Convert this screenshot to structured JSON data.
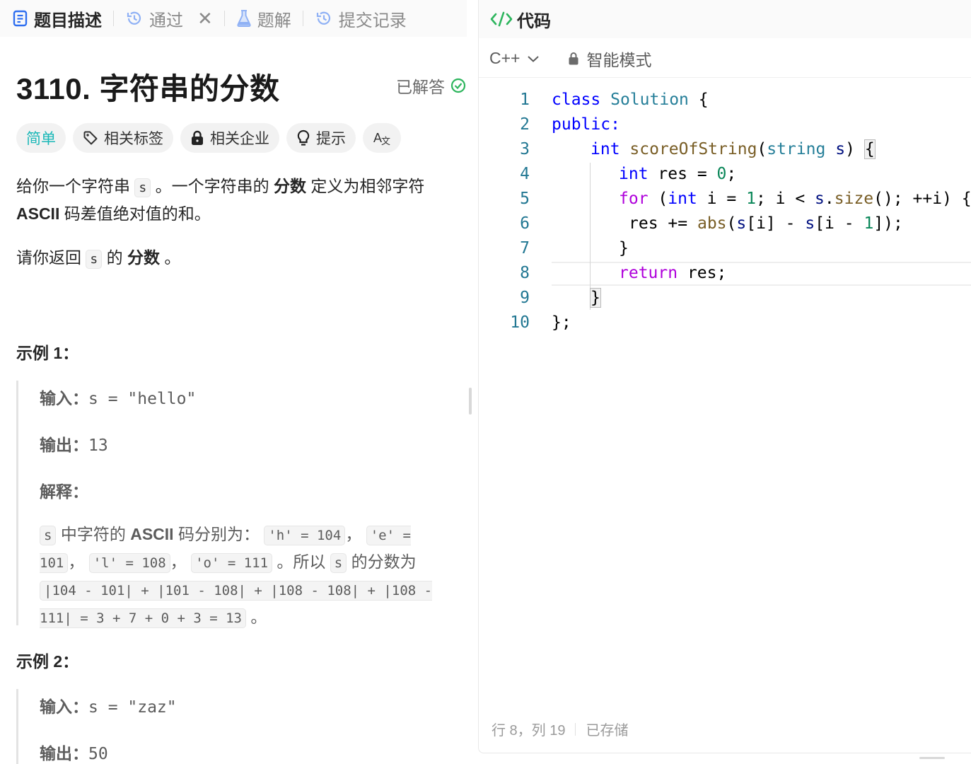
{
  "left_tabs": [
    {
      "label": "题目描述",
      "icon": "description-icon"
    },
    {
      "label": "通过",
      "icon": "history-icon"
    },
    {
      "label": "题解",
      "icon": "flask-icon"
    },
    {
      "label": "提交记录",
      "icon": "history-icon"
    }
  ],
  "problem": {
    "title": "3110. 字符串的分数",
    "status": "已解答",
    "tags": {
      "difficulty": "简单",
      "related_tags": "相关标签",
      "related_companies": "相关企业",
      "hint": "提示",
      "translate_icon": "translate-icon"
    },
    "desc1": {
      "a": "给你一个字符串",
      "code_s": "s",
      "b": "。一个字符串的",
      "bold": "分数",
      "c": "定义为相邻字符",
      "line2_bold": "ASCII",
      "line2_rest": "码差值绝对值的和。"
    },
    "desc2": {
      "a": "请你返回",
      "code_s": "s",
      "b": "的",
      "bold": "分数",
      "c": "。"
    },
    "example1": {
      "title": "示例 1：",
      "input_label": "输入：",
      "input_value": "s = \"hello\"",
      "output_label": "输出：",
      "output_value": "13",
      "explain_label": "解释：",
      "explain": {
        "code_s": "s",
        "t1": "中字符的",
        "ascii": "ASCII",
        "t2": "码分别为：",
        "h": "'h' = 104",
        "comma1": "，",
        "e": "'e' = 101",
        "comma2": "，",
        "l": "'l' = 108",
        "comma3": "，",
        "o": "'o' = 111",
        "t3": "。所以",
        "code_s2": "s",
        "t4": "的分数为",
        "expr": "|104 - 101| + |101 - 108| + |108 - 108| + |108 - 111| = 3 + 7 + 0 + 3 = 13",
        "end": "。"
      }
    },
    "example2": {
      "title": "示例 2：",
      "input_label": "输入：",
      "input_value": "s = \"zaz\"",
      "output_label": "输出：",
      "output_value": "50"
    }
  },
  "code_panel": {
    "title": "代码",
    "language": "C++",
    "mode": "智能模式",
    "line_numbers": [
      "1",
      "2",
      "3",
      "4",
      "5",
      "6",
      "7",
      "8",
      "9",
      "10"
    ],
    "lines": {
      "l1_kw": "class",
      "l1_name": "Solution",
      "l1_brace": "{",
      "l2": "public:",
      "l3_type": "int",
      "l3_fn": "scoreOfString",
      "l3_paren": "(",
      "l3_ptype": "string",
      "l3_param": "s",
      "l3_close": ")",
      "l3_brace": "{",
      "l4_type": "int",
      "l4_var": "res",
      "l4_eq": "=",
      "l4_num": "0",
      "l4_semi": ";",
      "l5_for": "for",
      "l5_open": "(",
      "l5_type": "int",
      "l5_rest1": "i =",
      "l5_num": "1",
      "l5_rest2": "; i <",
      "l5_s": "s",
      "l5_dot": ".",
      "l5_size": "size",
      "l5_rest3": "(); ++i) {",
      "l6_var": "res",
      "l6_op": "+=",
      "l6_fn": "abs",
      "l6_p1": "(",
      "l6_s1": "s",
      "l6_idx1": "[i] -",
      "l6_s2": "s",
      "l6_idx2": "[i -",
      "l6_num": "1",
      "l6_end": "]);",
      "l7": "}",
      "l8_kw": "return",
      "l8_rest": "res;",
      "l9": "}",
      "l10": "};"
    },
    "status_position": "行 8，列 19",
    "status_saved": "已存储"
  }
}
